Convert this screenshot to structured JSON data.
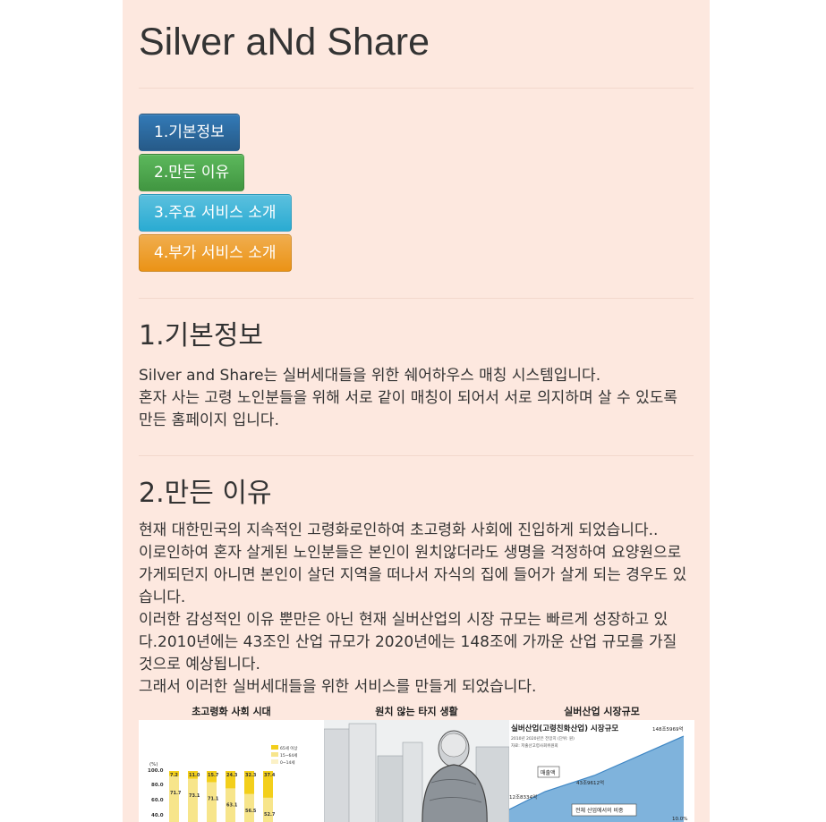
{
  "header": {
    "title": "Silver aNd Share"
  },
  "nav_buttons": [
    {
      "label": "1.기본정보",
      "color": "#2e6da4"
    },
    {
      "label": "2.만든 이유",
      "color": "#4cae4c"
    },
    {
      "label": "3.주요 서비스 소개",
      "color": "#46b8da"
    },
    {
      "label": "4.부가 서비스 소개",
      "color": "#eea236"
    }
  ],
  "section_basic": {
    "heading": "1.기본정보",
    "lines": [
      "Silver and Share는 실버세대들을 위한 쉐어하우스 매칭 시스템입니다.",
      "혼자 사는 고령 노인분들을 위해 서로 같이 매칭이 되어서 서로 의지하며 살 수 있도록 만든 홈페이지 입니다."
    ]
  },
  "section_reason": {
    "heading": "2.만든 이유",
    "lines": [
      "현재 대한민국의 지속적인 고령화로인하여 초고령화 사회에 진입하게 되었습니다..",
      "이로인하여 혼자 살게된 노인분들은 본인이 원치않더라도 생명을 걱정하여 요양원으로 가게되던지 아니면 본인이 살던 지역을 떠나서 자식의 집에 들어가 살게 되는 경우도 있습니다.",
      "이러한 감성적인 이유 뿐만은 아닌 현재 실버산업의 시장 규모는 빠르게 성장하고 있다.2010년에는 43조인 산업 규모가 2020년에는 148조에 가까운 산업 규모를 가질 것으로 예상됩니다.",
      "그래서 이러한 실버세대들을 위한 서비스를 만들게 되었습니다."
    ]
  },
  "figures": [
    {
      "caption": "초고령화 사회 시대",
      "legend": [
        "65세 이상",
        "15~64세",
        "0~14세"
      ],
      "y_label": "(%)",
      "y_ticks": [
        "100.0",
        "80.0",
        "60.0",
        "40.0"
      ],
      "top_values": [
        "7.2",
        "11.0",
        "15.7",
        "24.3",
        "32.3",
        "37.4"
      ],
      "mid_values": [
        "71.7",
        "73.1",
        "71.1",
        "63.1",
        "56.5",
        "52.7"
      ]
    },
    {
      "caption": "원치 않는 타지 생활"
    },
    {
      "caption": "실버산업 시장규모",
      "inner_title": "실버산업(고령친화산업) 시장규모",
      "note": "2010년 2020년은 전망치 (단위: 원)",
      "source": "자료: 저출산고령사회위원회",
      "labels": [
        "148조5969억",
        "43조9612억",
        "12조8334억",
        "매출액",
        "전체 산업에서의 비중",
        "10.0%"
      ]
    }
  ]
}
